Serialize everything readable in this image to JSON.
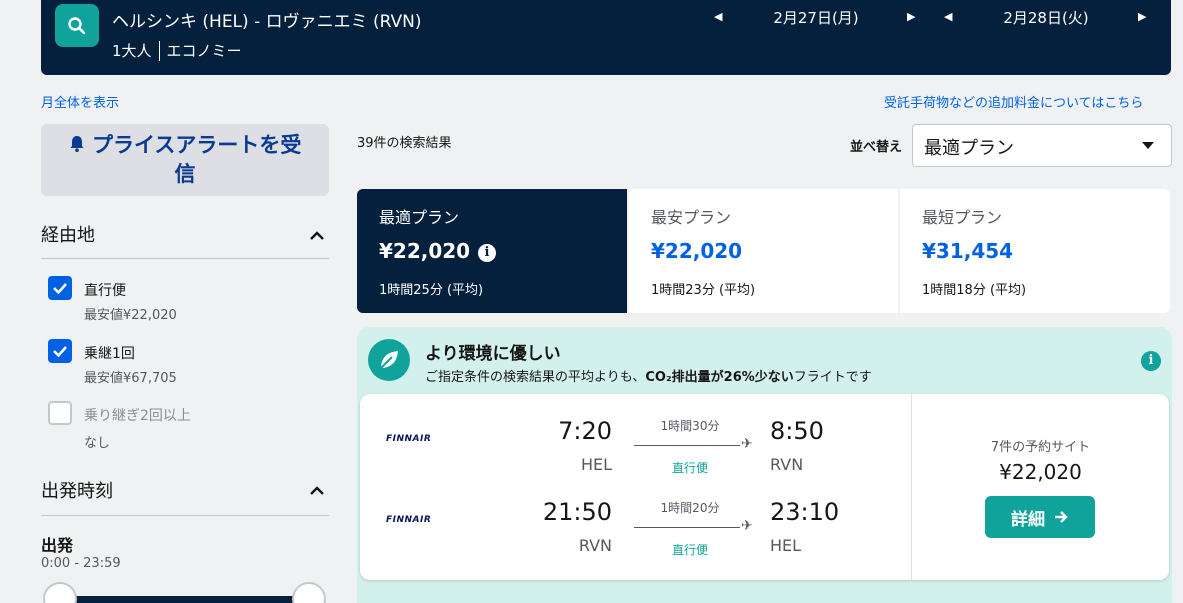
{
  "search": {
    "route": "ヘルシンキ (HEL) - ロヴァニエミ (RVN)",
    "passengers": "1大人",
    "cabin": "エコノミー",
    "depart_date": "2月27日(月)",
    "return_date": "2月28日(火)"
  },
  "links": {
    "month_view": "月全体を表示",
    "baggage_fees": "受託手荷物などの追加料金についてはこちら"
  },
  "sidebar": {
    "price_alert": "プライスアラートを受信",
    "stops": {
      "title": "経由地",
      "options": [
        {
          "label": "直行便",
          "sub": "最安値¥22,020",
          "checked": true
        },
        {
          "label": "乗継1回",
          "sub": "最安値¥67,705",
          "checked": true
        },
        {
          "label": "乗り継ぎ2回以上",
          "sub": "なし",
          "checked": false
        }
      ]
    },
    "departure": {
      "title": "出発時刻",
      "label": "出発",
      "range": "0:00 - 23:59"
    }
  },
  "results": {
    "count": "39件の検索結果",
    "sort_label": "並べ替え",
    "sort_value": "最適プラン",
    "tabs": [
      {
        "name": "最適プラン",
        "price": "¥22,020",
        "duration": "1時間25分 (平均)"
      },
      {
        "name": "最安プラン",
        "price": "¥22,020",
        "duration": "1時間23分 (平均)"
      },
      {
        "name": "最短プラン",
        "price": "¥31,454",
        "duration": "1時間18分 (平均)"
      }
    ],
    "eco": {
      "title": "より環境に優しい",
      "desc_pre": "ご指定条件の検索結果の平均よりも、",
      "desc_bold": "CO₂排出量が26%少ない",
      "desc_post": "フライトです"
    },
    "card": {
      "outbound": {
        "airline": "FINNAIR",
        "dep_time": "7:20",
        "dep_code": "HEL",
        "duration": "1時間30分",
        "stops": "直行便",
        "arr_time": "8:50",
        "arr_code": "RVN"
      },
      "inbound": {
        "airline": "FINNAIR",
        "dep_time": "21:50",
        "dep_code": "RVN",
        "duration": "1時間20分",
        "stops": "直行便",
        "arr_time": "23:10",
        "arr_code": "HEL"
      },
      "sites": "7件の予約サイト",
      "price": "¥22,020",
      "detail": "詳細"
    }
  },
  "colors": {
    "navy": "#05203c",
    "teal": "#0fa39b",
    "link_blue": "#0062e3",
    "eco_bg": "#d2f1ec"
  }
}
